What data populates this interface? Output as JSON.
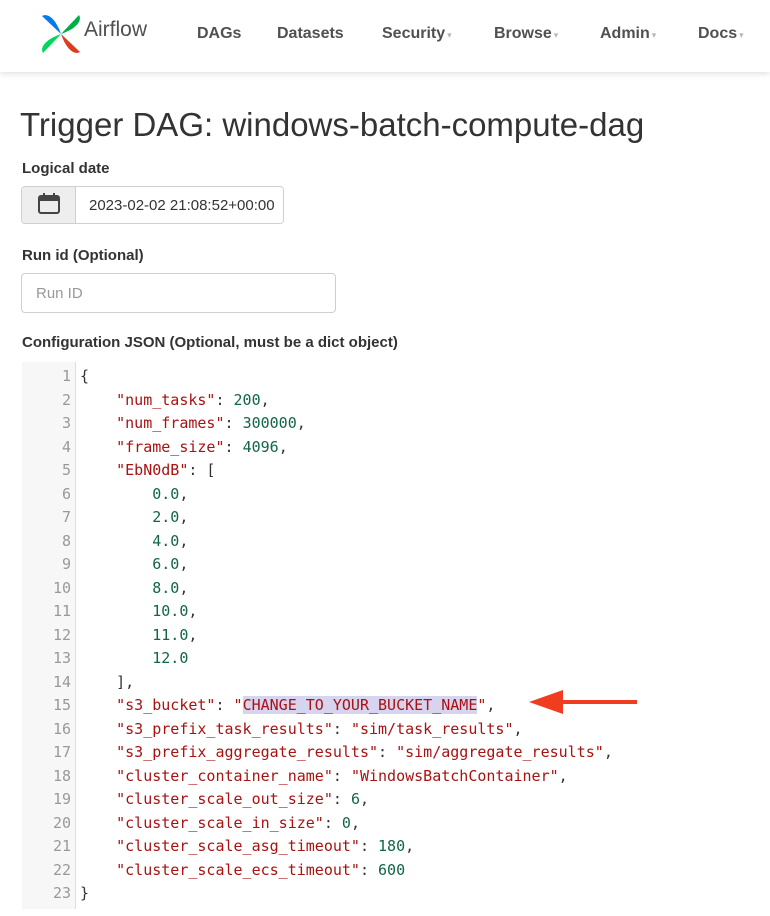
{
  "navbar": {
    "brand": "Airflow",
    "items": [
      {
        "label": "DAGs",
        "dropdown": false
      },
      {
        "label": "Datasets",
        "dropdown": false
      },
      {
        "label": "Security",
        "dropdown": true
      },
      {
        "label": "Browse",
        "dropdown": true
      },
      {
        "label": "Admin",
        "dropdown": true
      },
      {
        "label": "Docs",
        "dropdown": true
      }
    ],
    "caret": "▾"
  },
  "page": {
    "title": "Trigger DAG: windows-batch-compute-dag"
  },
  "form": {
    "logical_date_label": "Logical date",
    "logical_date_value": "2023-02-02 21:08:52+00:00",
    "run_id_label": "Run id (Optional)",
    "run_id_placeholder": "Run ID",
    "run_id_value": "",
    "config_label": "Configuration JSON (Optional, must be a dict object)"
  },
  "config_json": {
    "lines": [
      "{",
      "    \"num_tasks\": 200,",
      "    \"num_frames\": 300000,",
      "    \"frame_size\": 4096,",
      "    \"EbN0dB\": [",
      "        0.0,",
      "        2.0,",
      "        4.0,",
      "        6.0,",
      "        8.0,",
      "        10.0,",
      "        11.0,",
      "        12.0",
      "    ],",
      "    \"s3_bucket\": \"CHANGE_TO_YOUR_BUCKET_NAME\",",
      "    \"s3_prefix_task_results\": \"sim/task_results\",",
      "    \"s3_prefix_aggregate_results\": \"sim/aggregate_results\",",
      "    \"cluster_container_name\": \"WindowsBatchContainer\",",
      "    \"cluster_scale_out_size\": 6,",
      "    \"cluster_scale_in_size\": 0,",
      "    \"cluster_scale_asg_timeout\": 180,",
      "    \"cluster_scale_ecs_timeout\": 600",
      "}"
    ],
    "highlighted_text": "CHANGE_TO_YOUR_BUCKET_NAME",
    "highlighted_line": 15
  },
  "colors": {
    "json_key": "#aa1111",
    "json_number": "#116644",
    "highlight": "#d7d4f0",
    "arrow": "#f03c1f"
  },
  "icons": {
    "calendar": "calendar-icon",
    "logo": "airflow-logo-icon",
    "annotation": "arrow-left-icon"
  }
}
